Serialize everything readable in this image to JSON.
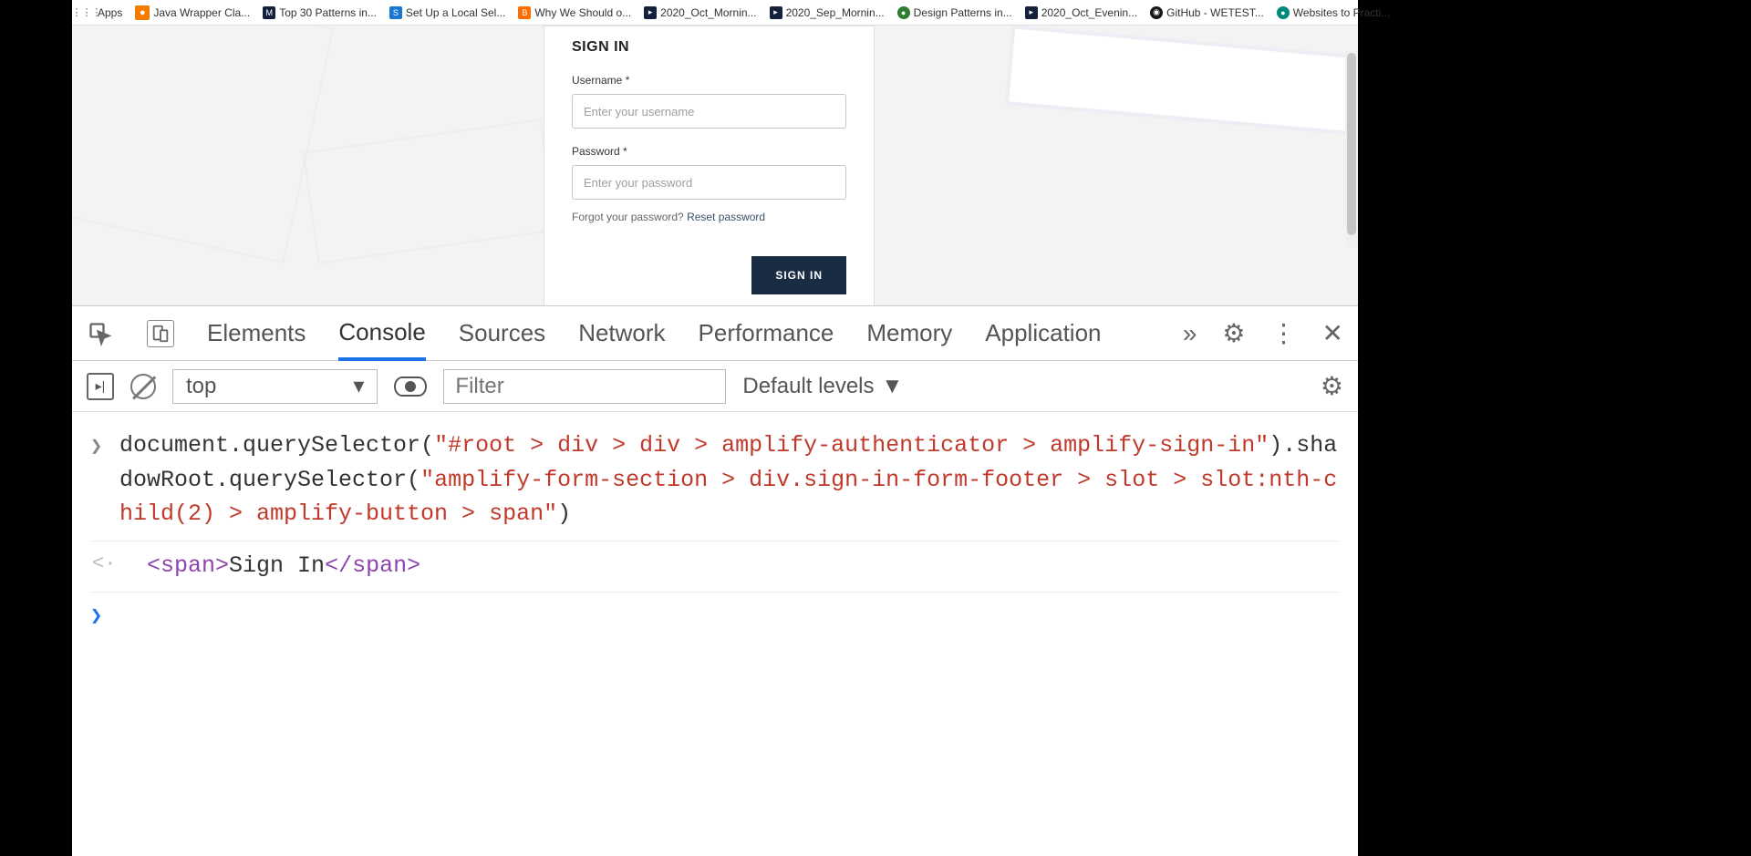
{
  "bookmarks": {
    "apps": "Apps",
    "items": [
      "Java Wrapper Cla...",
      "Top 30 Patterns in...",
      "Set Up a Local Sel...",
      "Why We Should o...",
      "2020_Oct_Mornin...",
      "2020_Sep_Mornin...",
      "Design Patterns in...",
      "2020_Oct_Evenin...",
      "GitHub - WETEST...",
      "Websites to Practi..."
    ]
  },
  "signin": {
    "title": "SIGN IN",
    "username_label": "Username *",
    "username_placeholder": "Enter your username",
    "password_label": "Password *",
    "password_placeholder": "Enter your password",
    "forgot_text": "Forgot your password? ",
    "reset_link": "Reset password",
    "button": "SIGN IN"
  },
  "devtools": {
    "tabs": {
      "elements": "Elements",
      "console": "Console",
      "sources": "Sources",
      "network": "Network",
      "performance": "Performance",
      "memory": "Memory",
      "application": "Application"
    },
    "context": "top",
    "filter_placeholder": "Filter",
    "levels": "Default levels",
    "console_input_pre": "document.querySelector(",
    "console_input_str1": "\"#root > div > div > amplify-authenticator > amplify-sign-in\"",
    "console_input_mid": ").shadowRoot.querySelector(",
    "console_input_str2": "\"amplify-form-section > div.sign-in-form-footer > slot > slot:nth-child(2) > amplify-button > span\"",
    "console_input_post": ")",
    "result_open": "<span>",
    "result_text": "Sign In",
    "result_close": "</span>"
  }
}
